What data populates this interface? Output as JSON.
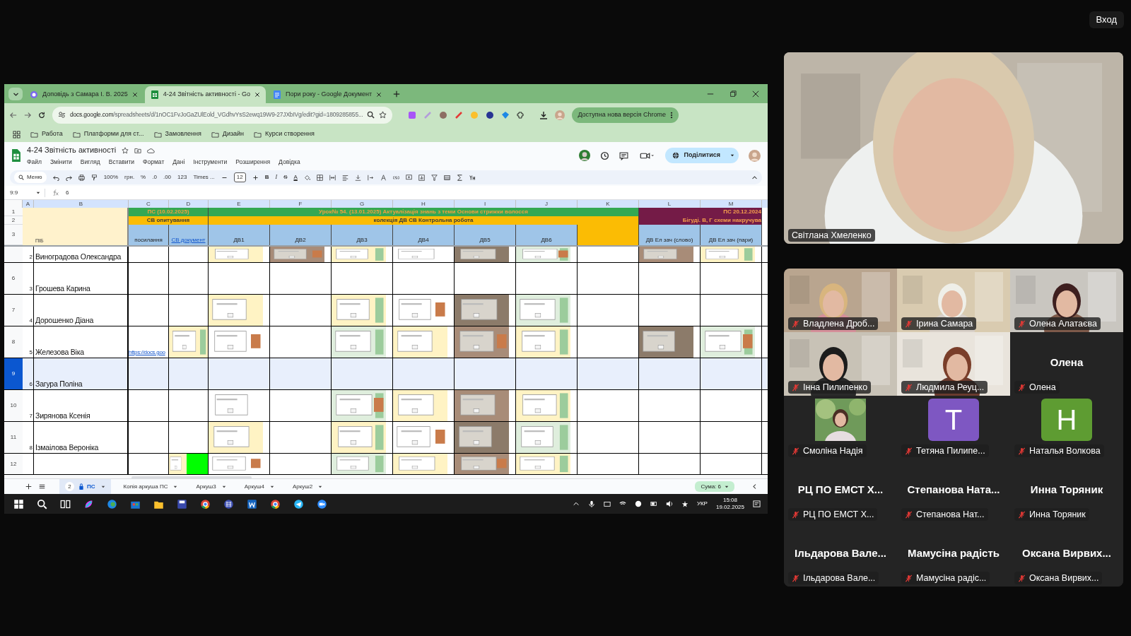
{
  "meeting": {
    "sign_in": "Вход"
  },
  "browser": {
    "tabs": [
      {
        "title": "Доповідь з Самара І. В. 2025",
        "selected": false,
        "kind": "slides"
      },
      {
        "title": "4-24 Звітність активності - Go",
        "selected": true,
        "kind": "sheets"
      },
      {
        "title": "Пори року - Google Документ",
        "selected": false,
        "kind": "docs"
      }
    ],
    "address": {
      "host": "docs.google.com",
      "path": "/spreadsheets/d/1nOC1FvJoGaZUlEold_VGdhvYsS2ewq19W9-27JXbIVg/edit?gid=1809285855..."
    },
    "update_button": "Доступна нова версія Chrome",
    "bookmarks": [
      "Работа",
      "Платформи для ст...",
      "Замовлення",
      "Дизайн",
      "Курси створення"
    ]
  },
  "sheet": {
    "title": "4-24 Звітність активності",
    "menu": [
      "Файл",
      "Змінити",
      "Вигляд",
      "Вставити",
      "Формат",
      "Дані",
      "Інструменти",
      "Розширення",
      "Довідка"
    ],
    "share": "Поділитися",
    "toolbar": {
      "search": "Меню",
      "zoom": "100%",
      "currency": "грн.",
      "percent": "%",
      "dec_less": ".0",
      "dec_more": ".00",
      "number_format": "123",
      "font": "Times ...",
      "font_size": "12",
      "bold": "B",
      "italic": "I",
      "strike": "S",
      "text_color": "A"
    },
    "name_box": "9:9",
    "formula": "6",
    "columns": [
      "A",
      "B",
      "C",
      "D",
      "E",
      "F",
      "G",
      "H",
      "I",
      "J",
      "K",
      "L",
      "M"
    ],
    "header": {
      "row_numbers": [
        "1",
        "2",
        "3"
      ],
      "name_label": "ПІБ",
      "row1": [
        {
          "text": "ПС (10.02.2025)",
          "kind": "green"
        },
        {
          "text": "Урок№ 54. (13.01.2025) Актуалізація знань з теми Основи стрижки волосся",
          "kind": "green"
        },
        {
          "text": "ПС 20.12.2024",
          "kind": "maroon"
        }
      ],
      "row2": [
        {
          "text": "СВ опитування",
          "kind": "orange"
        },
        {
          "text": "колекція ДВ СВ Контрольна робота",
          "kind": "orange"
        },
        {
          "text": "Бігуді. В, Г схеми накручува",
          "kind": "maroon"
        }
      ],
      "row3": [
        {
          "text": "посилання",
          "kind": "plain"
        },
        {
          "text": "СВ документ",
          "kind": "link"
        },
        {
          "text": "ДВ1",
          "kind": "plain"
        },
        {
          "text": "ДВ2",
          "kind": "plain"
        },
        {
          "text": "ДВ3",
          "kind": "plain"
        },
        {
          "text": "ДВ4",
          "kind": "plain"
        },
        {
          "text": "ДВ5",
          "kind": "plain"
        },
        {
          "text": "ДВ6",
          "kind": "plain"
        },
        {
          "kind": "orange"
        },
        {
          "text": "ДВ Ел зач (слово)",
          "kind": "plain"
        },
        {
          "text": "ДВ Ел зач (пари)",
          "kind": "plain"
        }
      ]
    },
    "rows": [
      {
        "selected": false,
        "cells": [
          {
            "kind": "index",
            "text": "2"
          },
          {
            "kind": "name",
            "text": "Виноградова Олександра"
          },
          {
            "kind": "empty"
          },
          {
            "kind": "empty"
          },
          {
            "kind": "picture"
          },
          {
            "kind": "picture"
          },
          {
            "kind": "picture"
          },
          {
            "kind": "picture"
          },
          {
            "kind": "picture"
          },
          {
            "kind": "picture"
          },
          {
            "kind": "empty"
          },
          {
            "kind": "picture"
          },
          {
            "kind": "picture"
          }
        ]
      },
      {
        "number": "6",
        "selected": false,
        "cells": [
          {
            "kind": "index",
            "text": "3"
          },
          {
            "kind": "name",
            "text": "Грошева Карина"
          },
          {
            "kind": "empty"
          },
          {
            "kind": "empty"
          },
          {
            "kind": "empty"
          },
          {
            "kind": "empty"
          },
          {
            "kind": "empty"
          },
          {
            "kind": "empty"
          },
          {
            "kind": "empty"
          },
          {
            "kind": "empty"
          },
          {
            "kind": "empty"
          },
          {
            "kind": "empty"
          },
          {
            "kind": "empty"
          }
        ]
      },
      {
        "number": "7",
        "selected": false,
        "cells": [
          {
            "kind": "index",
            "text": "4"
          },
          {
            "kind": "name",
            "text": "Дорошенко Діана"
          },
          {
            "kind": "empty"
          },
          {
            "kind": "empty"
          },
          {
            "kind": "picture"
          },
          {
            "kind": "empty"
          },
          {
            "kind": "picture"
          },
          {
            "kind": "picture"
          },
          {
            "kind": "picture"
          },
          {
            "kind": "picture"
          },
          {
            "kind": "empty"
          },
          {
            "kind": "empty"
          },
          {
            "kind": "empty"
          }
        ]
      },
      {
        "number": "8",
        "selected": false,
        "cells": [
          {
            "kind": "index",
            "text": "5"
          },
          {
            "kind": "name",
            "text": "Железова Віка"
          },
          {
            "kind": "link",
            "text": "https://docs.goo"
          },
          {
            "kind": "picture"
          },
          {
            "kind": "picture"
          },
          {
            "kind": "empty"
          },
          {
            "kind": "picture"
          },
          {
            "kind": "picture"
          },
          {
            "kind": "picture"
          },
          {
            "kind": "picture"
          },
          {
            "kind": "empty"
          },
          {
            "kind": "picture"
          },
          {
            "kind": "picture"
          }
        ]
      },
      {
        "number": "9",
        "selected": true,
        "cells": [
          {
            "kind": "index",
            "text": "6"
          },
          {
            "kind": "name",
            "text": "Загура Поліна"
          },
          {
            "kind": "empty"
          },
          {
            "kind": "empty"
          },
          {
            "kind": "empty"
          },
          {
            "kind": "empty"
          },
          {
            "kind": "empty"
          },
          {
            "kind": "empty"
          },
          {
            "kind": "empty"
          },
          {
            "kind": "empty"
          },
          {
            "kind": "empty"
          },
          {
            "kind": "empty"
          },
          {
            "kind": "empty"
          }
        ]
      },
      {
        "number": "10",
        "selected": false,
        "cells": [
          {
            "kind": "index",
            "text": "7"
          },
          {
            "kind": "name",
            "text": "Зирянова Ксенія"
          },
          {
            "kind": "empty"
          },
          {
            "kind": "empty"
          },
          {
            "kind": "picture"
          },
          {
            "kind": "empty"
          },
          {
            "kind": "picture"
          },
          {
            "kind": "picture"
          },
          {
            "kind": "picture"
          },
          {
            "kind": "picture"
          },
          {
            "kind": "empty"
          },
          {
            "kind": "empty"
          },
          {
            "kind": "empty"
          }
        ]
      },
      {
        "number": "11",
        "selected": false,
        "cells": [
          {
            "kind": "index",
            "text": "8"
          },
          {
            "kind": "name",
            "text": "Ізмаілова Вероніка"
          },
          {
            "kind": "empty"
          },
          {
            "kind": "empty"
          },
          {
            "kind": "picture"
          },
          {
            "kind": "empty"
          },
          {
            "kind": "picture"
          },
          {
            "kind": "picture"
          },
          {
            "kind": "picture"
          },
          {
            "kind": "picture"
          },
          {
            "kind": "empty"
          },
          {
            "kind": "empty"
          },
          {
            "kind": "empty"
          }
        ]
      },
      {
        "number": "12",
        "selected": false,
        "cells": [
          {
            "kind": "empty"
          },
          {
            "kind": "empty"
          },
          {
            "kind": "empty"
          },
          {
            "kind": "fill",
            "color": "#00ff00"
          },
          {
            "kind": "picture"
          },
          {
            "kind": "empty"
          },
          {
            "kind": "picture"
          },
          {
            "kind": "picture"
          },
          {
            "kind": "picture"
          },
          {
            "kind": "picture"
          },
          {
            "kind": "empty"
          },
          {
            "kind": "empty"
          },
          {
            "kind": "empty"
          }
        ]
      }
    ],
    "sheet_tabs": [
      {
        "label": "ПС",
        "selected": true,
        "badge": "2",
        "locked": true
      },
      {
        "label": "Копія аркуша ПС",
        "selected": false,
        "locked": false
      },
      {
        "label": "Аркуш3",
        "selected": false,
        "locked": false
      },
      {
        "label": "Аркуш4",
        "selected": false,
        "locked": false
      },
      {
        "label": "Аркуш2",
        "selected": false,
        "locked": false
      }
    ],
    "sum": "Сума: 6"
  },
  "taskbar": {
    "language": "УКР",
    "time": "15:08",
    "date": "19.02.2025"
  },
  "participants": {
    "speaker": {
      "name": "Світлана Хмеленко",
      "muted": false
    },
    "tiles": [
      {
        "kind": "video",
        "name": "Владлена Дроб...",
        "muted": true
      },
      {
        "kind": "video",
        "name": "Ірина Самара",
        "muted": true
      },
      {
        "kind": "video",
        "name": "Олена Алатаєва",
        "muted": true
      },
      {
        "kind": "video",
        "name": "Інна Пилипенко",
        "muted": true
      },
      {
        "kind": "video",
        "name": "Людмила Реуц...",
        "muted": true
      },
      {
        "kind": "name",
        "display": "Олена",
        "name": "Олена",
        "muted": true
      },
      {
        "name": "Смоліна Надія",
        "muted": true
      },
      {
        "kind": "avatar",
        "letter": "T",
        "color": "#7e57c2",
        "name": "Тетяна Пилипе...",
        "muted": true
      },
      {
        "kind": "avatar",
        "letter": "H",
        "color": "#5e9c32",
        "name": "Наталья Волкова",
        "muted": true
      },
      {
        "kind": "name",
        "display": "РЦ ПО ЕМСТ Х...",
        "name": "РЦ ПО ЕМСТ Х...",
        "muted": true
      },
      {
        "kind": "name",
        "display": "Степанова  Ната...",
        "name": "Степанова Нат...",
        "muted": true
      },
      {
        "kind": "name",
        "display": "Инна Торяник",
        "name": "Инна Торяник",
        "muted": true
      },
      {
        "kind": "name",
        "display": "Ільдарова  Вале...",
        "name": "Ільдарова Вале...",
        "muted": true
      },
      {
        "kind": "name",
        "display": "Мамусіна радість",
        "name": "Мамусіна радіс...",
        "muted": true
      },
      {
        "kind": "name",
        "display": "Оксана  Вирвих...",
        "name": "Оксана Вирвих...",
        "muted": true
      }
    ]
  }
}
